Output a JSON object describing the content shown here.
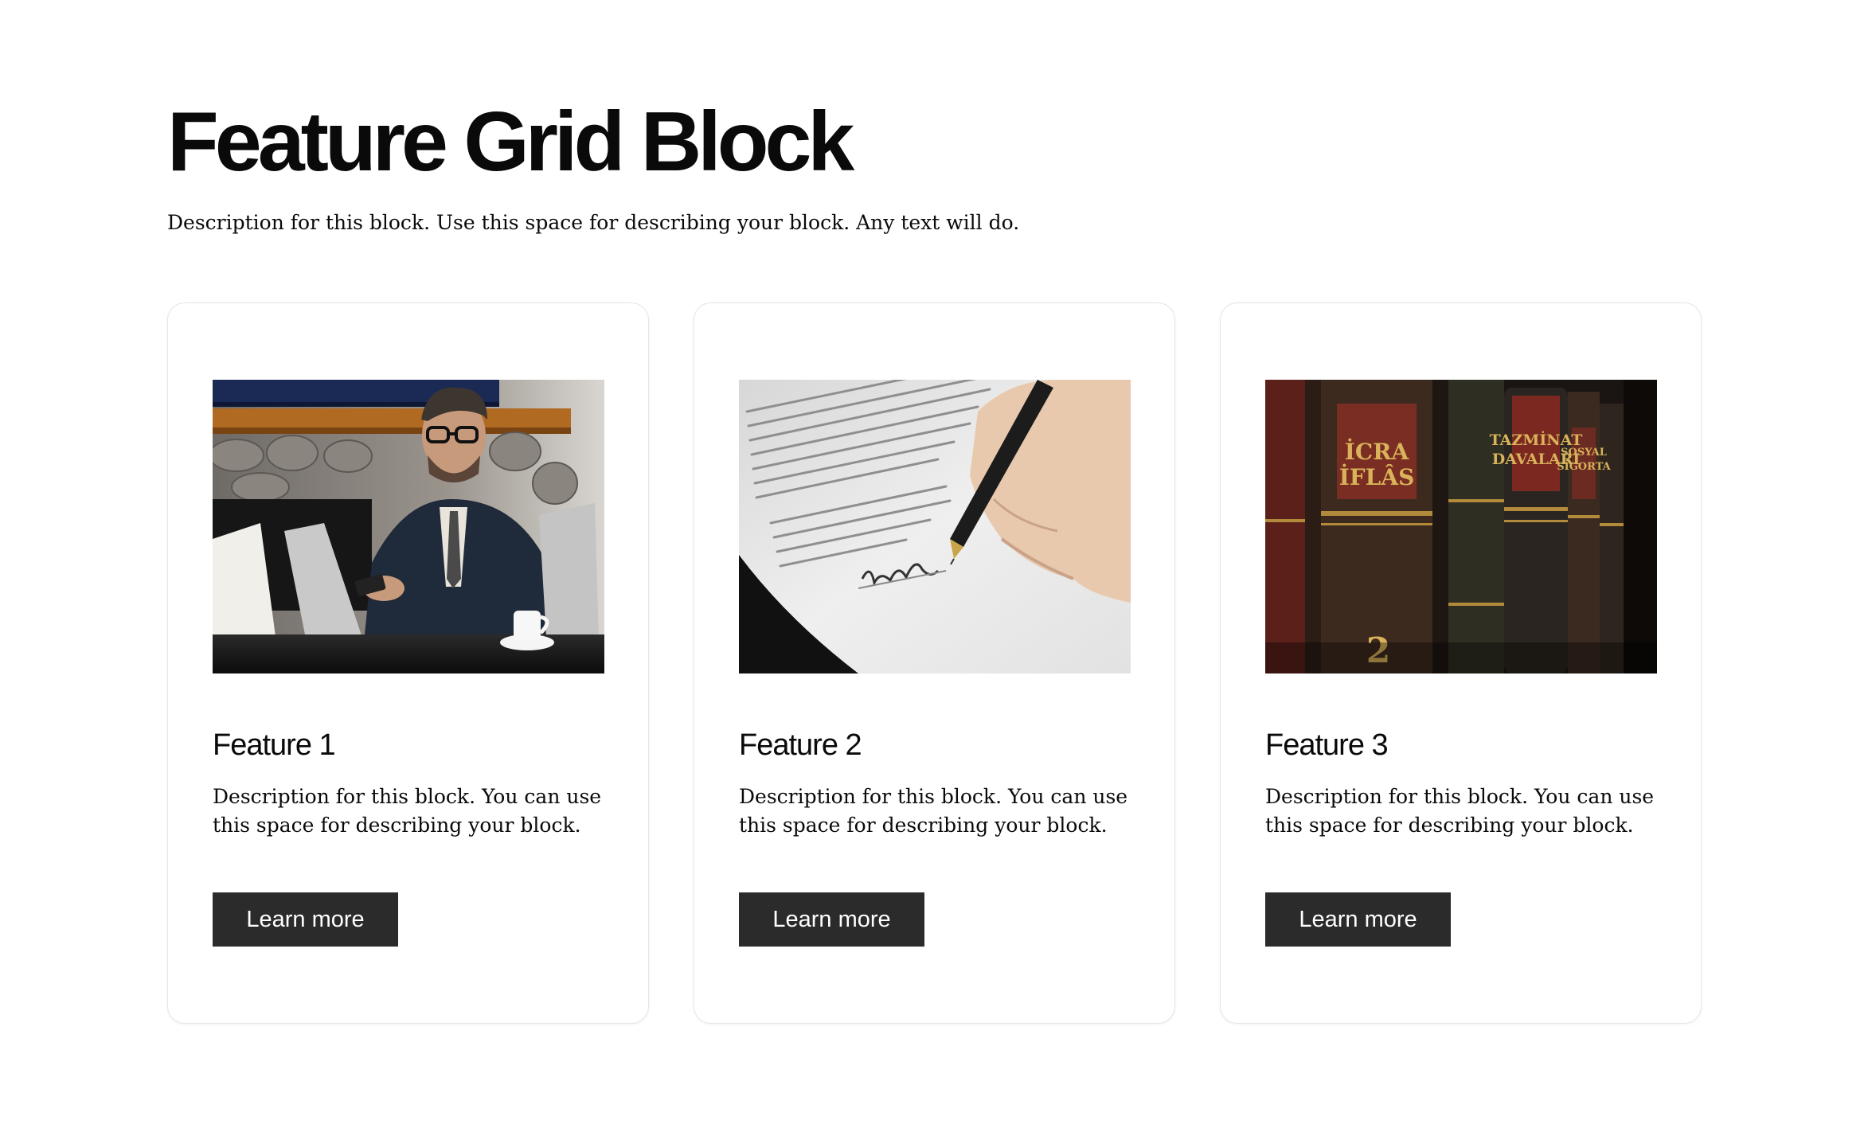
{
  "block": {
    "title": "Feature Grid Block",
    "description": "Description for this block. Use this space for describing your block. Any text will do."
  },
  "features": [
    {
      "title": "Feature 1",
      "description": "Description for this block. You can use this space for describing your block.",
      "button_label": "Learn more",
      "image": "businessman-with-laptop-photo"
    },
    {
      "title": "Feature 2",
      "description": "Description for this block. You can use this space for describing your block.",
      "button_label": "Learn more",
      "image": "hand-signing-document-photo"
    },
    {
      "title": "Feature 3",
      "description": "Description for this block. You can use this space for describing your block.",
      "button_label": "Learn more",
      "image": "law-books-on-shelf-photo",
      "image_text": [
        "İCRA",
        "İFLÂS",
        "TAZMİNAT",
        "DAVALARI",
        "SOSYAL",
        "SİGORTA",
        "2"
      ]
    }
  ],
  "colors": {
    "button_bg": "#2b2b2b",
    "button_text": "#ffffff",
    "card_border": "#e6e6e6",
    "text": "#0a0a0a"
  }
}
